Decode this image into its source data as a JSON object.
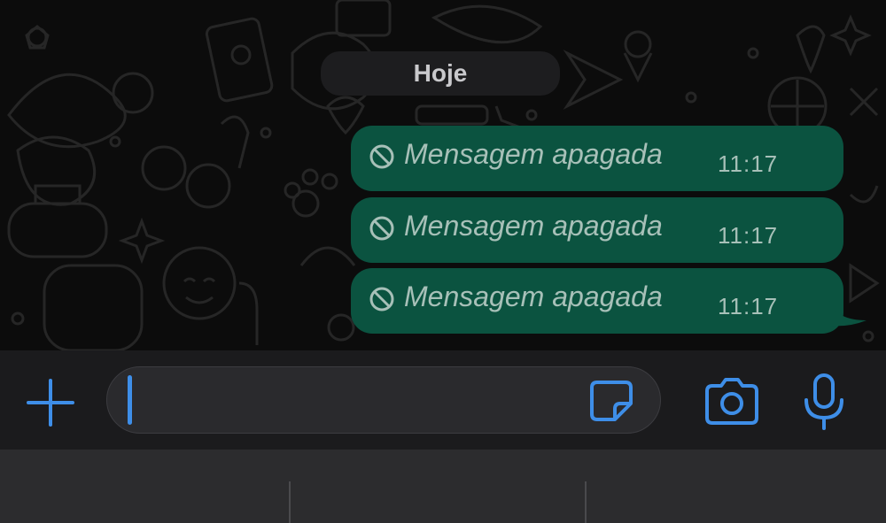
{
  "chat": {
    "date_label": "Hoje",
    "messages": [
      {
        "text": "Mensagem apagada",
        "time": "11:17",
        "icon": "deleted-message-icon"
      },
      {
        "text": "Mensagem apagada",
        "time": "11:17",
        "icon": "deleted-message-icon"
      },
      {
        "text": "Mensagem apagada",
        "time": "11:17",
        "icon": "deleted-message-icon"
      }
    ]
  },
  "composer": {
    "input_value": "",
    "buttons": [
      "plus-icon",
      "sticker-icon",
      "camera-icon",
      "microphone-icon"
    ]
  },
  "colors": {
    "bubble": "#0b5340",
    "accent": "#3e8ee8",
    "background": "#0c0c0c"
  }
}
